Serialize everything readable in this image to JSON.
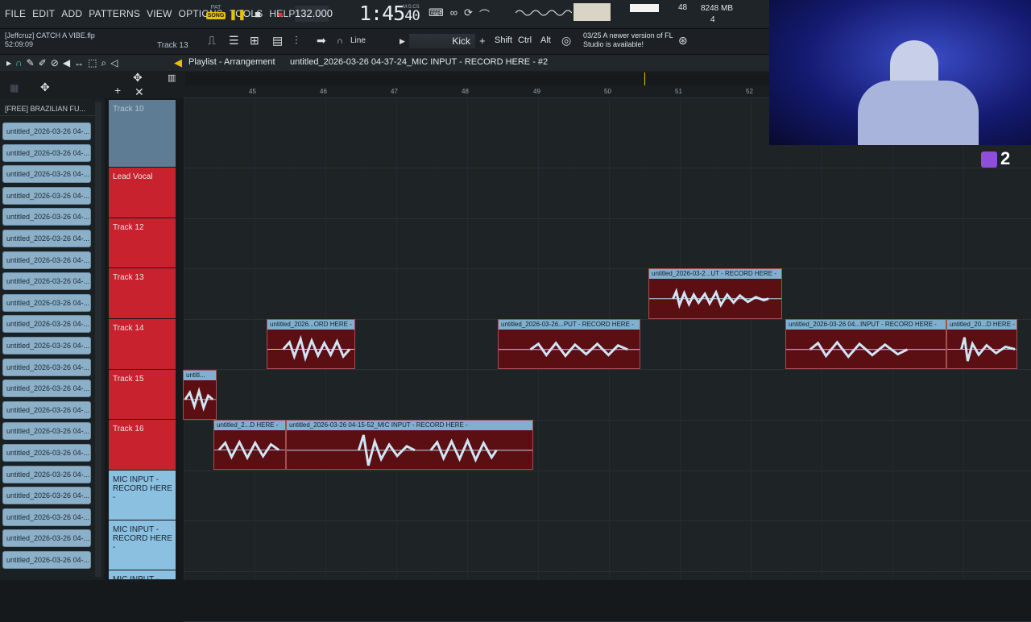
{
  "menu": [
    "FILE",
    "EDIT",
    "ADD",
    "PATTERNS",
    "VIEW",
    "OPTIONS",
    "TOOLS",
    "HELP"
  ],
  "transport": {
    "pat": "PAT",
    "song": "SONG",
    "tempo": "132.000",
    "time": "1:45",
    "subtime": "40",
    "time_unit": "M:S:CS",
    "cpu": "48",
    "memory": "8248 MB",
    "polyphony": "4"
  },
  "project": {
    "user": "[Jeffcruz] CATCH A VIBE.flp",
    "elapsed": "52:09:09",
    "track_hint": "Track 13"
  },
  "toolbar": {
    "line_label": "Line",
    "kick_label": "Kick",
    "shift": "Shift",
    "ctrl": "Ctrl",
    "alt": "Alt"
  },
  "news": {
    "date": "03/25",
    "text": "A newer version of FL Studio is available!"
  },
  "playlist": {
    "title": "Playlist - Arrangement",
    "crumb": "untitled_2026-03-26 04-37-24_MIC INPUT - RECORD HERE - #2"
  },
  "ruler": [
    "45",
    "46",
    "47",
    "48",
    "49",
    "50",
    "51",
    "52"
  ],
  "browser": {
    "header": "[FREE] BRAZILIAN FU...",
    "items": [
      "untitled_2026-03-26 04-...",
      "untitled_2026-03-26 04-...",
      "untitled_2026-03-26 04-...",
      "untitled_2026-03-26 04-...",
      "untitled_2026-03-26 04-...",
      "untitled_2026-03-26 04-...",
      "untitled_2026-03-26 04-...",
      "untitled_2026-03-26 04-...",
      "untitled_2026-03-26 04-...",
      "untitled_2026-03-26 04-...",
      "untitled_2026-03-26 04-...",
      "untitled_2026-03-26 04-...",
      "untitled_2026-03-26 04-...",
      "untitled_2026-03-26 04-...",
      "untitled_2026-03-26 04-...",
      "untitled_2026-03-26 04-...",
      "untitled_2026-03-26 04-...",
      "untitled_2026-03-26 04-...",
      "untitled_2026-03-26 04-...",
      "untitled_2026-03-26 04-...",
      "untitled_2026-03-26 04-..."
    ]
  },
  "tracks": [
    {
      "name": "Track 10",
      "color": "#5e7c94"
    },
    {
      "name": "Lead Vocal",
      "color": "#c8222e"
    },
    {
      "name": "Track 12",
      "color": "#c8222e"
    },
    {
      "name": "Track 13",
      "color": "#c8222e"
    },
    {
      "name": "Track 14",
      "color": "#c8222e"
    },
    {
      "name": "Track 15",
      "color": "#c8222e"
    },
    {
      "name": "Track 16",
      "color": "#c8222e"
    },
    {
      "name": "MIC INPUT - RECORD HERE -",
      "color": "#8cc0e0"
    },
    {
      "name": "MIC INPUT - RECORD HERE -",
      "color": "#8cc0e0"
    },
    {
      "name": "MIC INPUT -",
      "color": "#8cc0e0"
    }
  ],
  "clips": [
    {
      "label": "untitled_2026-03-2...UT - RECORD HERE -"
    },
    {
      "label": "untitled_2026...ORD HERE -"
    },
    {
      "label": "untitled_2026-03-26...PUT - RECORD HERE -"
    },
    {
      "label": "untitled_2026-03-26 04...INPUT - RECORD HERE -"
    },
    {
      "label": "untitled_20...D HERE -"
    },
    {
      "label": "untitl..."
    },
    {
      "label": "untitled_2...D HERE -"
    },
    {
      "label": "untitled_2026-03-26 04-15-52_MIC INPUT - RECORD HERE -"
    }
  ],
  "overlay": {
    "twitch_count": "2"
  }
}
